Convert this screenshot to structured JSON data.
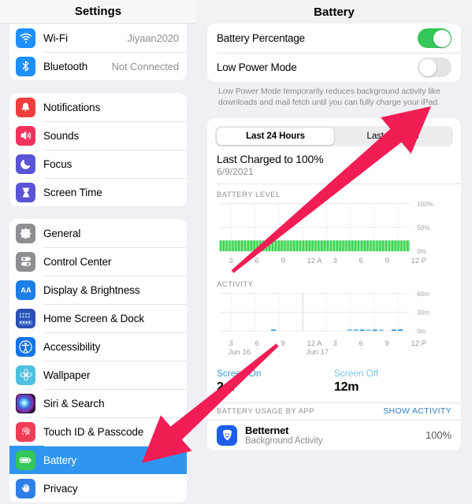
{
  "sidebar": {
    "title": "Settings",
    "groups": [
      {
        "items": [
          {
            "label": "Wi-Fi",
            "value": "Jiyaan2020",
            "icon": "wifi-icon",
            "color": "#1e8fff",
            "selected": false
          },
          {
            "label": "Bluetooth",
            "value": "Not Connected",
            "icon": "bluetooth-icon",
            "color": "#1e8fff",
            "selected": false
          }
        ]
      },
      {
        "items": [
          {
            "label": "Notifications",
            "value": "",
            "icon": "notifications-icon",
            "color": "#f03d3d",
            "selected": false
          },
          {
            "label": "Sounds",
            "value": "",
            "icon": "sounds-icon",
            "color": "#f0325c",
            "selected": false
          },
          {
            "label": "Focus",
            "value": "",
            "icon": "focus-moon-icon",
            "color": "#5a54d6",
            "selected": false
          },
          {
            "label": "Screen Time",
            "value": "",
            "icon": "screen-time-hourglass-icon",
            "color": "#5a54d6",
            "selected": false
          }
        ]
      },
      {
        "items": [
          {
            "label": "General",
            "value": "",
            "icon": "gear-icon",
            "color": "#8e8e93",
            "selected": false
          },
          {
            "label": "Control Center",
            "value": "",
            "icon": "control-center-icon",
            "color": "#8e8e93",
            "selected": false
          },
          {
            "label": "Display & Brightness",
            "value": "",
            "icon": "display-brightness-aa-icon",
            "color": "#1e7ee8",
            "selected": false
          },
          {
            "label": "Home Screen & Dock",
            "value": "",
            "icon": "home-screen-dock-icon",
            "color": "#2c4fb5",
            "selected": false
          },
          {
            "label": "Accessibility",
            "value": "",
            "icon": "accessibility-icon",
            "color": "#1273e6",
            "selected": false
          },
          {
            "label": "Wallpaper",
            "value": "",
            "icon": "wallpaper-flower-icon",
            "color": "#4fc0e0",
            "selected": false
          },
          {
            "label": "Siri & Search",
            "value": "",
            "icon": "siri-search-icon",
            "color": "#2b1b3a",
            "selected": false
          },
          {
            "label": "Touch ID & Passcode",
            "value": "",
            "icon": "touch-id-fingerprint-icon",
            "color": "#f03d55",
            "selected": false
          },
          {
            "label": "Battery",
            "value": "",
            "icon": "battery-icon",
            "color": "#34c759",
            "selected": true
          },
          {
            "label": "Privacy",
            "value": "",
            "icon": "privacy-hand-icon",
            "color": "#2f7fe8",
            "selected": false
          }
        ]
      }
    ]
  },
  "main": {
    "title": "Battery",
    "settings": {
      "battery_percentage_label": "Battery Percentage",
      "battery_percentage_on": true,
      "low_power_mode_label": "Low Power Mode",
      "low_power_mode_on": false,
      "footnote": "Low Power Mode temporarily reduces background activity like downloads and mail fetch until you can fully charge your iPad."
    },
    "segmented": {
      "options": [
        "Last 24 Hours",
        "Last 10 Days"
      ],
      "selected_index": 0
    },
    "last_charged_title": "Last Charged to 100%",
    "last_charged_date": "6/9/2021",
    "battery_level_caption": "BATTERY LEVEL",
    "activity_caption": "ACTIVITY",
    "screen_on_label": "Screen On",
    "screen_on_value": "2m",
    "screen_off_label": "Screen Off",
    "screen_off_value": "12m",
    "usage_caption": "BATTERY USAGE BY APP",
    "show_activity_label": "SHOW ACTIVITY",
    "apps": [
      {
        "name": "Betternet",
        "subtitle": "Background Activity",
        "percent": "100%",
        "icon": "betternet-shield-icon",
        "color": "#1f5ee8"
      }
    ]
  },
  "chart_data": [
    {
      "type": "bar",
      "title": "BATTERY LEVEL",
      "ylabel": "",
      "xlabel": "",
      "ylim": [
        0,
        100
      ],
      "ytick_labels": [
        "100%",
        "50%",
        "0%"
      ],
      "ytick_values": [
        100,
        50,
        0
      ],
      "xtick_labels": [
        "3",
        "6",
        "9",
        "12 A",
        "3",
        "6",
        "9",
        "12 P"
      ],
      "grid": true,
      "bar_color": "#3cd44f",
      "categories": [
        "3",
        "",
        "",
        "",
        "6",
        "",
        "",
        "",
        "9",
        "",
        "",
        "",
        "12 A",
        "",
        "",
        "",
        "3",
        "",
        "",
        "",
        "6",
        "",
        "",
        "",
        "9",
        "",
        "",
        "",
        "12 P",
        ""
      ],
      "values": [
        12,
        12,
        12,
        12,
        12,
        12,
        12,
        12,
        12,
        12,
        12,
        12,
        12,
        12,
        12,
        12,
        12,
        12,
        12,
        12,
        12,
        12,
        12,
        12,
        12,
        12,
        12,
        12,
        12,
        12
      ],
      "note": "Uniform low battery level band spanning full 24 hours"
    },
    {
      "type": "bar",
      "title": "ACTIVITY",
      "ylabel": "",
      "xlabel": "",
      "ylim": [
        0,
        60
      ],
      "ytick_labels": [
        "60m",
        "30m",
        "0m"
      ],
      "ytick_values": [
        60,
        30,
        0
      ],
      "xtick_labels": [
        "3",
        "6",
        "9",
        "12 A",
        "3",
        "6",
        "9",
        "12 P"
      ],
      "xsub_labels": [
        "Jun 16",
        "Jun 17"
      ],
      "grid": true,
      "series": [
        {
          "name": "Screen On",
          "color": "#3f9ad8",
          "values": [
            0,
            0,
            0,
            0,
            0,
            0,
            0,
            0,
            1.2,
            0,
            0,
            0,
            0,
            0,
            0,
            0,
            0,
            0,
            0,
            0,
            0,
            1.0,
            2.0,
            0,
            1.2,
            0,
            0,
            1.5,
            2.5,
            0
          ]
        },
        {
          "name": "Screen Off",
          "color": "#7fc3e5",
          "values": [
            0,
            0,
            0,
            0,
            0,
            0,
            0,
            0,
            0,
            0,
            0,
            0,
            0,
            0,
            0,
            0,
            0,
            0,
            0,
            0,
            2.5,
            2.5,
            0,
            1.5,
            0,
            1.2,
            0,
            0,
            0,
            0
          ]
        }
      ]
    }
  ],
  "annotations": {
    "arrow_color": "#f31d56",
    "arrows": [
      {
        "name": "arrow-to-low-power-toggle",
        "from": [
          295,
          345
        ],
        "to": [
          547,
          135
        ]
      },
      {
        "name": "arrow-to-battery-sidebar-item",
        "from": [
          352,
          438
        ],
        "to": [
          180,
          588
        ]
      }
    ]
  }
}
